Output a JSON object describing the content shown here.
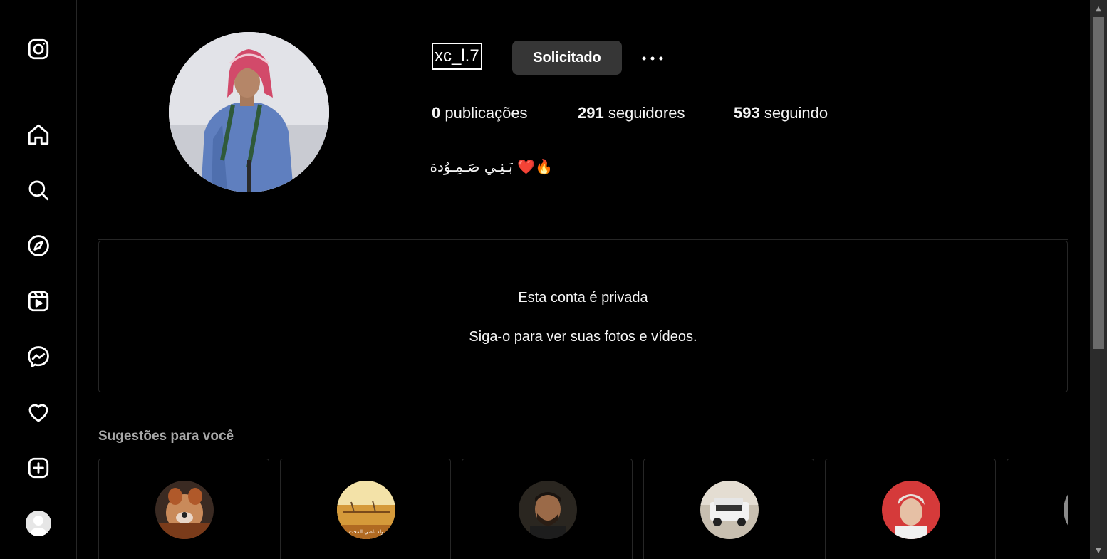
{
  "sidebar": {
    "items": [
      {
        "name": "instagram-logo-icon"
      },
      {
        "name": "home-icon"
      },
      {
        "name": "search-icon"
      },
      {
        "name": "explore-compass-icon"
      },
      {
        "name": "reels-icon"
      },
      {
        "name": "messenger-icon"
      },
      {
        "name": "heart-notifications-icon"
      },
      {
        "name": "create-plus-icon"
      },
      {
        "name": "profile-avatar"
      }
    ]
  },
  "profile": {
    "username": "xc_l.7",
    "follow_button_label": "Solicitado",
    "more_label": "•••",
    "stats": {
      "posts_count": "0",
      "posts_label": " publicações",
      "followers_count": "291",
      "followers_label": " seguidores",
      "following_count": "593",
      "following_label": " seguindo"
    },
    "bio": "🔥❤️ بَـنِـي صَـمِـوُدة"
  },
  "private_notice": {
    "title": "Esta conta é privada",
    "subtitle": "Siga-o para ver suas fotos e vídeos."
  },
  "suggestions": {
    "title": "Sugestões para você",
    "cards": [
      {
        "avatar": "filter-selfie"
      },
      {
        "avatar": "desert-scene",
        "caption": "ولد ناصي المخت"
      },
      {
        "avatar": "man-portrait"
      },
      {
        "avatar": "white-suv"
      },
      {
        "avatar": "man-red-headscarf"
      },
      {
        "avatar": "partial"
      }
    ]
  },
  "colors": {
    "background": "#000000",
    "text": "#f5f5f5",
    "button": "#363636",
    "border": "#262626",
    "muted": "#a8a8a8"
  }
}
